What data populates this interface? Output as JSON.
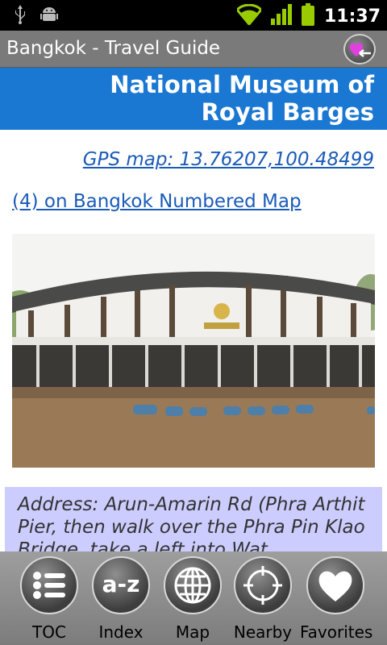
{
  "status_bar": {
    "time": "11:37",
    "icons": [
      "usb-icon",
      "android-debug-icon",
      "wifi-icon",
      "signal-icon",
      "battery-icon"
    ]
  },
  "app_bar": {
    "title": "Bangkok - Travel Guide",
    "button_icon": "favorite-back-icon"
  },
  "page": {
    "title": "National Museum of Royal Barges",
    "gps_link": "GPS map: 13.76207,100.48499",
    "map_link": "(4) on Bangkok Numbered Map",
    "address": "Address: Arun-Amarin Rd (Phra Arthit Pier, then walk over the Phra Pin Klao Bridge, take a left into Wat Dusitaram"
  },
  "toolbar": {
    "items": [
      {
        "label": "TOC",
        "icon": "list-icon"
      },
      {
        "label": "Index",
        "icon": "a-z-icon",
        "glyph": "a-z"
      },
      {
        "label": "Map",
        "icon": "globe-icon"
      },
      {
        "label": "Nearby",
        "icon": "crosshair-icon"
      },
      {
        "label": "Favorites",
        "icon": "heart-icon"
      }
    ]
  },
  "colors": {
    "header_blue": "#1a78d2",
    "link_blue": "#1a5bb8",
    "address_bg": "#ccccff",
    "accent_green": "#99cc00"
  }
}
